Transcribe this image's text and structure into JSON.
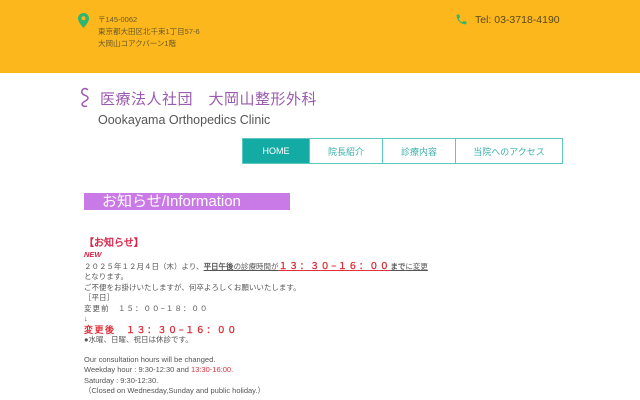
{
  "header": {
    "postal": "〒145-0062",
    "address1": "東京都大田区北千束1丁目57-6",
    "address2": "大岡山コアクバーン1階",
    "tel": "Tel: 03-3718-4190",
    "color": "#fbb71b"
  },
  "clinic": {
    "title": "医療法人社団　大岡山整形外科",
    "subtitle": "Oookayama Orthopedics Clinic"
  },
  "nav": [
    {
      "label": "HOME"
    },
    {
      "label": "院長紹介"
    },
    {
      "label": "診療内容"
    },
    {
      "label": "当院へのアクセス"
    }
  ],
  "info": {
    "heading": "お知らせ/Information",
    "notice_title": "【お知らせ】",
    "new": "NEW",
    "l1a": "２０２５年１２月４日（木）より、",
    "l1b": "平日午後",
    "l1c": "の診療時間が",
    "l1d": "１３：３０−１６：００",
    "l1e": "まで",
    "l1f": "に変更",
    "l2": "となります。",
    "l3": "ご不便をお掛けいたしますが、何卒よろしくお願いいたします。",
    "l4": "［平日］",
    "l5": "変更前　１５：００−１８：００",
    "arrow": "↓",
    "l6": "変更後　１３：３０−１６：００",
    "l7": "●水曜、日曜、祝日は休診です。",
    "e1": "Our consultation hours will be changed.",
    "e2a": "Weekday hour : 9:30-12:30 and ",
    "e2b": "13:30-16:00.",
    "e3": "Saturday : 9:30-12:30.",
    "e4": "（Closed on Wednesday,Sunday and public holiday.）"
  }
}
